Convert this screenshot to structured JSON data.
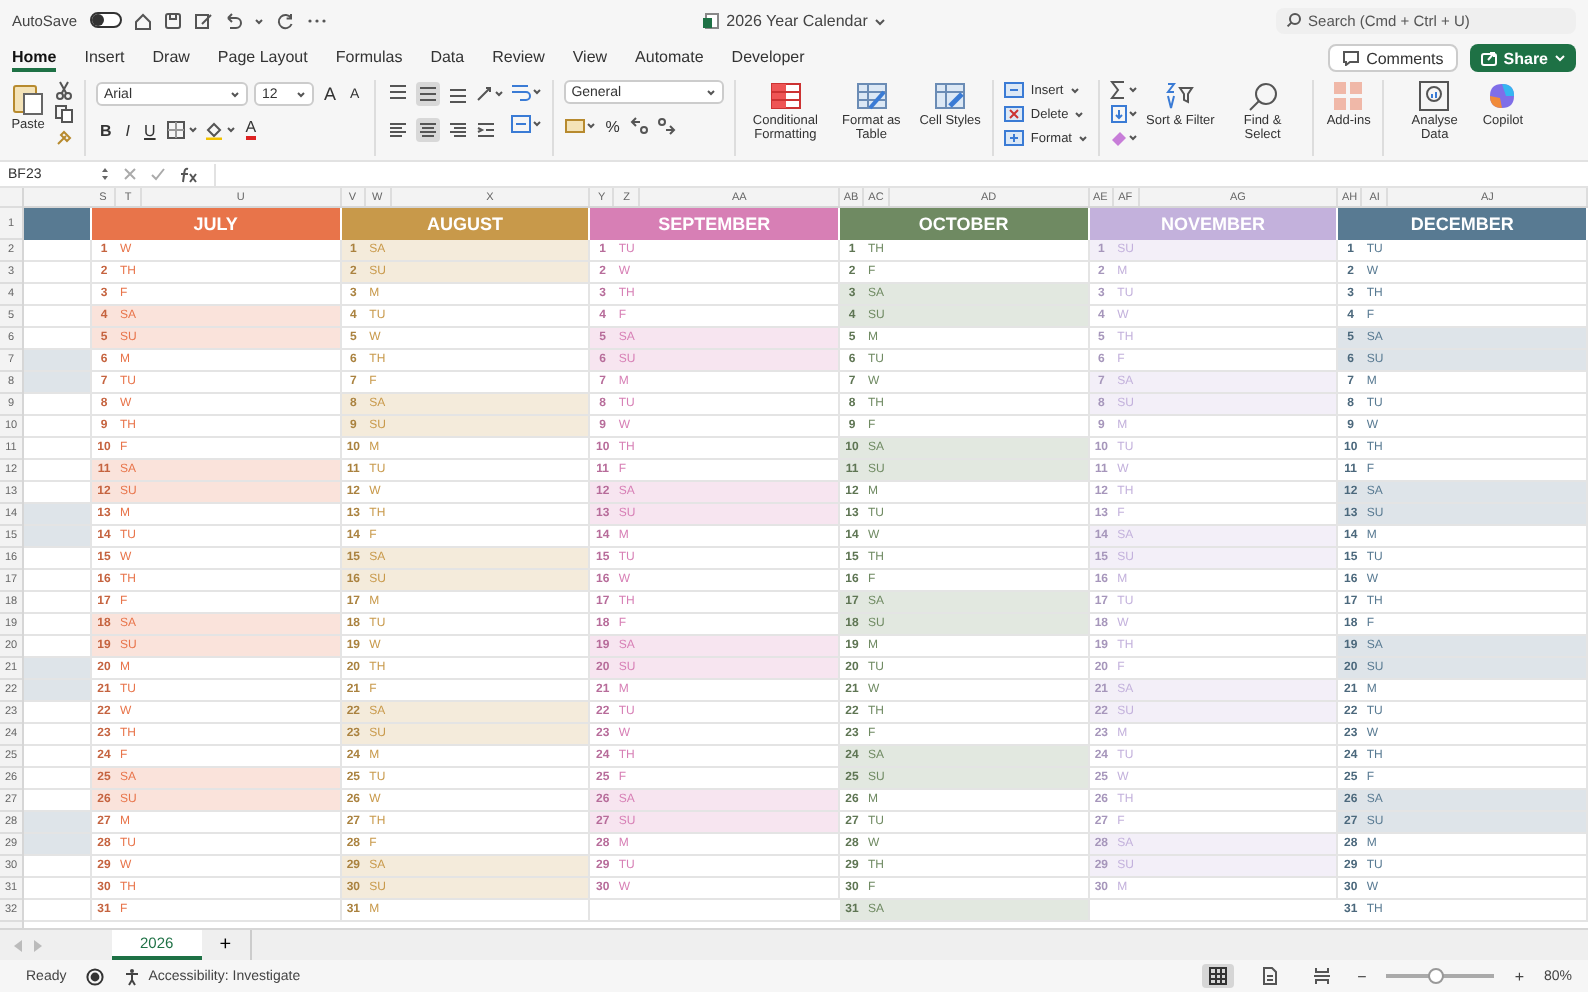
{
  "title_bar": {
    "autosave_label": "AutoSave",
    "autosave_on": false,
    "title": "2026 Year Calendar",
    "search_placeholder": "Search (Cmd + Ctrl + U)"
  },
  "tabs": [
    {
      "label": "Home",
      "selected": true
    },
    {
      "label": "Insert",
      "selected": false
    },
    {
      "label": "Draw",
      "selected": false
    },
    {
      "label": "Page Layout",
      "selected": false
    },
    {
      "label": "Formulas",
      "selected": false
    },
    {
      "label": "Data",
      "selected": false
    },
    {
      "label": "Review",
      "selected": false
    },
    {
      "label": "View",
      "selected": false
    },
    {
      "label": "Automate",
      "selected": false
    },
    {
      "label": "Developer",
      "selected": false
    }
  ],
  "comments_button": "Comments",
  "share_button": "Share",
  "ribbon": {
    "paste": "Paste",
    "font": "Arial",
    "font_size": "12",
    "font_size_buttons": [
      "A",
      "A"
    ],
    "font_styles": [
      "B",
      "I",
      "U"
    ],
    "font_color": "A",
    "vertical_align": [
      {
        "selected": false
      },
      {
        "selected": true
      },
      {
        "selected": false
      }
    ],
    "horizontal_align": [
      {
        "selected": false
      },
      {
        "selected": true
      },
      {
        "selected": false
      }
    ],
    "number_format": "General",
    "percent": "%",
    "style_buttons": [
      "Conditional Formatting",
      "Format as Table",
      "Cell Styles"
    ],
    "cell_buttons": [
      "Insert",
      "Delete",
      "Format"
    ],
    "edit_buttons": [
      "Sort & Filter",
      "Find & Select"
    ],
    "addins": "Add-ins",
    "extra_buttons": [
      "Analyse Data",
      "Copilot"
    ]
  },
  "formula_bar": {
    "name_box": "BF23"
  },
  "row_numbers": [
    "1",
    "2",
    "3",
    "4",
    "5",
    "6",
    "7",
    "8",
    "9",
    "10",
    "11",
    "12",
    "13",
    "14",
    "15",
    "16",
    "17",
    "18",
    "19",
    "20",
    "21",
    "22",
    "23",
    "24",
    "25",
    "26",
    "27",
    "28",
    "29",
    "30",
    "31",
    "32"
  ],
  "previous_month": {
    "color": "#587a92",
    "days": [
      {
        "weekend": false
      },
      {
        "weekend": false
      },
      {
        "weekend": false
      },
      {
        "weekend": false
      },
      {
        "weekend": false
      },
      {
        "weekend": true
      },
      {
        "weekend": true
      },
      {
        "weekend": false
      },
      {
        "weekend": false
      },
      {
        "weekend": false
      },
      {
        "weekend": false
      },
      {
        "weekend": false
      },
      {
        "weekend": true
      },
      {
        "weekend": true
      },
      {
        "weekend": false
      },
      {
        "weekend": false
      },
      {
        "weekend": false
      },
      {
        "weekend": false
      },
      {
        "weekend": false
      },
      {
        "weekend": true
      },
      {
        "weekend": true
      },
      {
        "weekend": false
      },
      {
        "weekend": false
      },
      {
        "weekend": false
      },
      {
        "weekend": false
      },
      {
        "weekend": false
      },
      {
        "weekend": true
      },
      {
        "weekend": true
      },
      {
        "weekend": false
      },
      {
        "weekend": false
      }
    ]
  },
  "months": [
    {
      "name": "JULY",
      "color": "#e8744a",
      "columns": [
        "S",
        "T",
        "U"
      ],
      "days": [
        {
          "day": "1",
          "weekday": "W",
          "weekend": false
        },
        {
          "day": "2",
          "weekday": "TH",
          "weekend": false
        },
        {
          "day": "3",
          "weekday": "F",
          "weekend": false
        },
        {
          "day": "4",
          "weekday": "SA",
          "weekend": true
        },
        {
          "day": "5",
          "weekday": "SU",
          "weekend": true
        },
        {
          "day": "6",
          "weekday": "M",
          "weekend": false
        },
        {
          "day": "7",
          "weekday": "TU",
          "weekend": false
        },
        {
          "day": "8",
          "weekday": "W",
          "weekend": false
        },
        {
          "day": "9",
          "weekday": "TH",
          "weekend": false
        },
        {
          "day": "10",
          "weekday": "F",
          "weekend": false
        },
        {
          "day": "11",
          "weekday": "SA",
          "weekend": true
        },
        {
          "day": "12",
          "weekday": "SU",
          "weekend": true
        },
        {
          "day": "13",
          "weekday": "M",
          "weekend": false
        },
        {
          "day": "14",
          "weekday": "TU",
          "weekend": false
        },
        {
          "day": "15",
          "weekday": "W",
          "weekend": false
        },
        {
          "day": "16",
          "weekday": "TH",
          "weekend": false
        },
        {
          "day": "17",
          "weekday": "F",
          "weekend": false
        },
        {
          "day": "18",
          "weekday": "SA",
          "weekend": true
        },
        {
          "day": "19",
          "weekday": "SU",
          "weekend": true
        },
        {
          "day": "20",
          "weekday": "M",
          "weekend": false
        },
        {
          "day": "21",
          "weekday": "TU",
          "weekend": false
        },
        {
          "day": "22",
          "weekday": "W",
          "weekend": false
        },
        {
          "day": "23",
          "weekday": "TH",
          "weekend": false
        },
        {
          "day": "24",
          "weekday": "F",
          "weekend": false
        },
        {
          "day": "25",
          "weekday": "SA",
          "weekend": true
        },
        {
          "day": "26",
          "weekday": "SU",
          "weekend": true
        },
        {
          "day": "27",
          "weekday": "M",
          "weekend": false
        },
        {
          "day": "28",
          "weekday": "TU",
          "weekend": false
        },
        {
          "day": "29",
          "weekday": "W",
          "weekend": false
        },
        {
          "day": "30",
          "weekday": "TH",
          "weekend": false
        },
        {
          "day": "31",
          "weekday": "F",
          "weekend": false
        }
      ]
    },
    {
      "name": "AUGUST",
      "color": "#c8994a",
      "columns": [
        "V",
        "W",
        "X"
      ],
      "days": [
        {
          "day": "1",
          "weekday": "SA",
          "weekend": true
        },
        {
          "day": "2",
          "weekday": "SU",
          "weekend": true
        },
        {
          "day": "3",
          "weekday": "M",
          "weekend": false
        },
        {
          "day": "4",
          "weekday": "TU",
          "weekend": false
        },
        {
          "day": "5",
          "weekday": "W",
          "weekend": false
        },
        {
          "day": "6",
          "weekday": "TH",
          "weekend": false
        },
        {
          "day": "7",
          "weekday": "F",
          "weekend": false
        },
        {
          "day": "8",
          "weekday": "SA",
          "weekend": true
        },
        {
          "day": "9",
          "weekday": "SU",
          "weekend": true
        },
        {
          "day": "10",
          "weekday": "M",
          "weekend": false
        },
        {
          "day": "11",
          "weekday": "TU",
          "weekend": false
        },
        {
          "day": "12",
          "weekday": "W",
          "weekend": false
        },
        {
          "day": "13",
          "weekday": "TH",
          "weekend": false
        },
        {
          "day": "14",
          "weekday": "F",
          "weekend": false
        },
        {
          "day": "15",
          "weekday": "SA",
          "weekend": true
        },
        {
          "day": "16",
          "weekday": "SU",
          "weekend": true
        },
        {
          "day": "17",
          "weekday": "M",
          "weekend": false
        },
        {
          "day": "18",
          "weekday": "TU",
          "weekend": false
        },
        {
          "day": "19",
          "weekday": "W",
          "weekend": false
        },
        {
          "day": "20",
          "weekday": "TH",
          "weekend": false
        },
        {
          "day": "21",
          "weekday": "F",
          "weekend": false
        },
        {
          "day": "22",
          "weekday": "SA",
          "weekend": true
        },
        {
          "day": "23",
          "weekday": "SU",
          "weekend": true
        },
        {
          "day": "24",
          "weekday": "M",
          "weekend": false
        },
        {
          "day": "25",
          "weekday": "TU",
          "weekend": false
        },
        {
          "day": "26",
          "weekday": "W",
          "weekend": false
        },
        {
          "day": "27",
          "weekday": "TH",
          "weekend": false
        },
        {
          "day": "28",
          "weekday": "F",
          "weekend": false
        },
        {
          "day": "29",
          "weekday": "SA",
          "weekend": true
        },
        {
          "day": "30",
          "weekday": "SU",
          "weekend": true
        },
        {
          "day": "31",
          "weekday": "M",
          "weekend": false
        }
      ]
    },
    {
      "name": "SEPTEMBER",
      "color": "#d77fb5",
      "columns": [
        "Y",
        "Z",
        "AA"
      ],
      "days": [
        {
          "day": "1",
          "weekday": "TU",
          "weekend": false
        },
        {
          "day": "2",
          "weekday": "W",
          "weekend": false
        },
        {
          "day": "3",
          "weekday": "TH",
          "weekend": false
        },
        {
          "day": "4",
          "weekday": "F",
          "weekend": false
        },
        {
          "day": "5",
          "weekday": "SA",
          "weekend": true
        },
        {
          "day": "6",
          "weekday": "SU",
          "weekend": true
        },
        {
          "day": "7",
          "weekday": "M",
          "weekend": false
        },
        {
          "day": "8",
          "weekday": "TU",
          "weekend": false
        },
        {
          "day": "9",
          "weekday": "W",
          "weekend": false
        },
        {
          "day": "10",
          "weekday": "TH",
          "weekend": false
        },
        {
          "day": "11",
          "weekday": "F",
          "weekend": false
        },
        {
          "day": "12",
          "weekday": "SA",
          "weekend": true
        },
        {
          "day": "13",
          "weekday": "SU",
          "weekend": true
        },
        {
          "day": "14",
          "weekday": "M",
          "weekend": false
        },
        {
          "day": "15",
          "weekday": "TU",
          "weekend": false
        },
        {
          "day": "16",
          "weekday": "W",
          "weekend": false
        },
        {
          "day": "17",
          "weekday": "TH",
          "weekend": false
        },
        {
          "day": "18",
          "weekday": "F",
          "weekend": false
        },
        {
          "day": "19",
          "weekday": "SA",
          "weekend": true
        },
        {
          "day": "20",
          "weekday": "SU",
          "weekend": true
        },
        {
          "day": "21",
          "weekday": "M",
          "weekend": false
        },
        {
          "day": "22",
          "weekday": "TU",
          "weekend": false
        },
        {
          "day": "23",
          "weekday": "W",
          "weekend": false
        },
        {
          "day": "24",
          "weekday": "TH",
          "weekend": false
        },
        {
          "day": "25",
          "weekday": "F",
          "weekend": false
        },
        {
          "day": "26",
          "weekday": "SA",
          "weekend": true
        },
        {
          "day": "27",
          "weekday": "SU",
          "weekend": true
        },
        {
          "day": "28",
          "weekday": "M",
          "weekend": false
        },
        {
          "day": "29",
          "weekday": "TU",
          "weekend": false
        },
        {
          "day": "30",
          "weekday": "W",
          "weekend": false
        }
      ]
    },
    {
      "name": "OCTOBER",
      "color": "#6f8a62",
      "columns": [
        "AB",
        "AC",
        "AD"
      ],
      "days": [
        {
          "day": "1",
          "weekday": "TH",
          "weekend": false
        },
        {
          "day": "2",
          "weekday": "F",
          "weekend": false
        },
        {
          "day": "3",
          "weekday": "SA",
          "weekend": true
        },
        {
          "day": "4",
          "weekday": "SU",
          "weekend": true
        },
        {
          "day": "5",
          "weekday": "M",
          "weekend": false
        },
        {
          "day": "6",
          "weekday": "TU",
          "weekend": false
        },
        {
          "day": "7",
          "weekday": "W",
          "weekend": false
        },
        {
          "day": "8",
          "weekday": "TH",
          "weekend": false
        },
        {
          "day": "9",
          "weekday": "F",
          "weekend": false
        },
        {
          "day": "10",
          "weekday": "SA",
          "weekend": true
        },
        {
          "day": "11",
          "weekday": "SU",
          "weekend": true
        },
        {
          "day": "12",
          "weekday": "M",
          "weekend": false
        },
        {
          "day": "13",
          "weekday": "TU",
          "weekend": false
        },
        {
          "day": "14",
          "weekday": "W",
          "weekend": false
        },
        {
          "day": "15",
          "weekday": "TH",
          "weekend": false
        },
        {
          "day": "16",
          "weekday": "F",
          "weekend": false
        },
        {
          "day": "17",
          "weekday": "SA",
          "weekend": true
        },
        {
          "day": "18",
          "weekday": "SU",
          "weekend": true
        },
        {
          "day": "19",
          "weekday": "M",
          "weekend": false
        },
        {
          "day": "20",
          "weekday": "TU",
          "weekend": false
        },
        {
          "day": "21",
          "weekday": "W",
          "weekend": false
        },
        {
          "day": "22",
          "weekday": "TH",
          "weekend": false
        },
        {
          "day": "23",
          "weekday": "F",
          "weekend": false
        },
        {
          "day": "24",
          "weekday": "SA",
          "weekend": true
        },
        {
          "day": "25",
          "weekday": "SU",
          "weekend": true
        },
        {
          "day": "26",
          "weekday": "M",
          "weekend": false
        },
        {
          "day": "27",
          "weekday": "TU",
          "weekend": false
        },
        {
          "day": "28",
          "weekday": "W",
          "weekend": false
        },
        {
          "day": "29",
          "weekday": "TH",
          "weekend": false
        },
        {
          "day": "30",
          "weekday": "F",
          "weekend": false
        },
        {
          "day": "31",
          "weekday": "SA",
          "weekend": true
        }
      ]
    },
    {
      "name": "NOVEMBER",
      "color": "#c3b1dc",
      "columns": [
        "AE",
        "AF",
        "AG"
      ],
      "days": [
        {
          "day": "1",
          "weekday": "SU",
          "weekend": true
        },
        {
          "day": "2",
          "weekday": "M",
          "weekend": false
        },
        {
          "day": "3",
          "weekday": "TU",
          "weekend": false
        },
        {
          "day": "4",
          "weekday": "W",
          "weekend": false
        },
        {
          "day": "5",
          "weekday": "TH",
          "weekend": false
        },
        {
          "day": "6",
          "weekday": "F",
          "weekend": false
        },
        {
          "day": "7",
          "weekday": "SA",
          "weekend": true
        },
        {
          "day": "8",
          "weekday": "SU",
          "weekend": true
        },
        {
          "day": "9",
          "weekday": "M",
          "weekend": false
        },
        {
          "day": "10",
          "weekday": "TU",
          "weekend": false
        },
        {
          "day": "11",
          "weekday": "W",
          "weekend": false
        },
        {
          "day": "12",
          "weekday": "TH",
          "weekend": false
        },
        {
          "day": "13",
          "weekday": "F",
          "weekend": false
        },
        {
          "day": "14",
          "weekday": "SA",
          "weekend": true
        },
        {
          "day": "15",
          "weekday": "SU",
          "weekend": true
        },
        {
          "day": "16",
          "weekday": "M",
          "weekend": false
        },
        {
          "day": "17",
          "weekday": "TU",
          "weekend": false
        },
        {
          "day": "18",
          "weekday": "W",
          "weekend": false
        },
        {
          "day": "19",
          "weekday": "TH",
          "weekend": false
        },
        {
          "day": "20",
          "weekday": "F",
          "weekend": false
        },
        {
          "day": "21",
          "weekday": "SA",
          "weekend": true
        },
        {
          "day": "22",
          "weekday": "SU",
          "weekend": true
        },
        {
          "day": "23",
          "weekday": "M",
          "weekend": false
        },
        {
          "day": "24",
          "weekday": "TU",
          "weekend": false
        },
        {
          "day": "25",
          "weekday": "W",
          "weekend": false
        },
        {
          "day": "26",
          "weekday": "TH",
          "weekend": false
        },
        {
          "day": "27",
          "weekday": "F",
          "weekend": false
        },
        {
          "day": "28",
          "weekday": "SA",
          "weekend": true
        },
        {
          "day": "29",
          "weekday": "SU",
          "weekend": true
        },
        {
          "day": "30",
          "weekday": "M",
          "weekend": false
        }
      ]
    },
    {
      "name": "DECEMBER",
      "color": "#587a92",
      "columns": [
        "AH",
        "AI",
        "AJ"
      ],
      "days": [
        {
          "day": "1",
          "weekday": "TU",
          "weekend": false
        },
        {
          "day": "2",
          "weekday": "W",
          "weekend": false
        },
        {
          "day": "3",
          "weekday": "TH",
          "weekend": false
        },
        {
          "day": "4",
          "weekday": "F",
          "weekend": false
        },
        {
          "day": "5",
          "weekday": "SA",
          "weekend": true
        },
        {
          "day": "6",
          "weekday": "SU",
          "weekend": true
        },
        {
          "day": "7",
          "weekday": "M",
          "weekend": false
        },
        {
          "day": "8",
          "weekday": "TU",
          "weekend": false
        },
        {
          "day": "9",
          "weekday": "W",
          "weekend": false
        },
        {
          "day": "10",
          "weekday": "TH",
          "weekend": false
        },
        {
          "day": "11",
          "weekday": "F",
          "weekend": false
        },
        {
          "day": "12",
          "weekday": "SA",
          "weekend": true
        },
        {
          "day": "13",
          "weekday": "SU",
          "weekend": true
        },
        {
          "day": "14",
          "weekday": "M",
          "weekend": false
        },
        {
          "day": "15",
          "weekday": "TU",
          "weekend": false
        },
        {
          "day": "16",
          "weekday": "W",
          "weekend": false
        },
        {
          "day": "17",
          "weekday": "TH",
          "weekend": false
        },
        {
          "day": "18",
          "weekday": "F",
          "weekend": false
        },
        {
          "day": "19",
          "weekday": "SA",
          "weekend": true
        },
        {
          "day": "20",
          "weekday": "SU",
          "weekend": true
        },
        {
          "day": "21",
          "weekday": "M",
          "weekend": false
        },
        {
          "day": "22",
          "weekday": "TU",
          "weekend": false
        },
        {
          "day": "23",
          "weekday": "W",
          "weekend": false
        },
        {
          "day": "24",
          "weekday": "TH",
          "weekend": false
        },
        {
          "day": "25",
          "weekday": "F",
          "weekend": false
        },
        {
          "day": "26",
          "weekday": "SA",
          "weekend": true
        },
        {
          "day": "27",
          "weekday": "SU",
          "weekend": true
        },
        {
          "day": "28",
          "weekday": "M",
          "weekend": false
        },
        {
          "day": "29",
          "weekday": "TU",
          "weekend": false
        },
        {
          "day": "30",
          "weekday": "W",
          "weekend": false
        },
        {
          "day": "31",
          "weekday": "TH",
          "weekend": false
        }
      ]
    }
  ],
  "sheet_tabs": [
    {
      "label": "2026",
      "selected": true
    }
  ],
  "add_sheet": "+",
  "status_bar": {
    "status": "Ready",
    "accessibility": "Accessibility: Investigate",
    "views": [
      {
        "selected": true
      },
      {
        "selected": false
      },
      {
        "selected": false
      }
    ],
    "zoom_out": "−",
    "zoom_in": "+",
    "zoom": {
      "level": 0.45,
      "label": "80%"
    }
  }
}
